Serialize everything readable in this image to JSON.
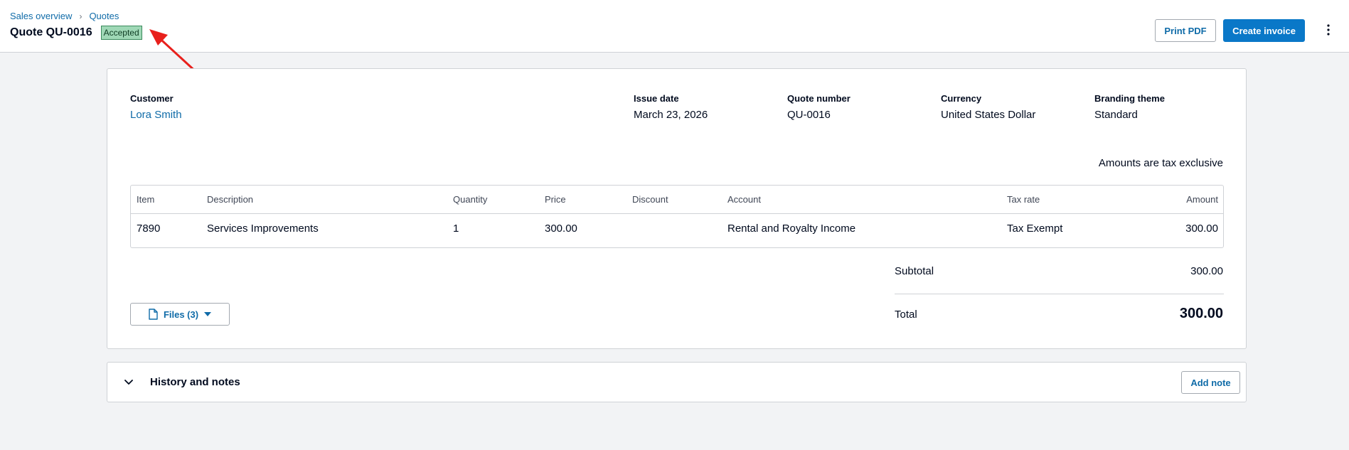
{
  "breadcrumb": {
    "items": [
      "Sales overview",
      "Quotes"
    ],
    "separator": "›"
  },
  "header": {
    "title": "Quote QU-0016",
    "status": "Accepted",
    "print_label": "Print PDF",
    "create_label": "Create invoice"
  },
  "quote": {
    "customer_label": "Customer",
    "customer_name": "Lora Smith",
    "issue_date_label": "Issue date",
    "issue_date": "March 23, 2026",
    "number_label": "Quote number",
    "number": "QU-0016",
    "currency_label": "Currency",
    "currency": "United States Dollar",
    "branding_label": "Branding theme",
    "branding": "Standard",
    "tax_note": "Amounts are tax exclusive"
  },
  "table": {
    "columns": [
      "Item",
      "Description",
      "Quantity",
      "Price",
      "Discount",
      "Account",
      "Tax rate",
      "Amount"
    ],
    "rows": [
      [
        "7890",
        "Services Improvements",
        "1",
        "300.00",
        "",
        "Rental and Royalty Income",
        "Tax Exempt",
        "300.00"
      ]
    ]
  },
  "summary": {
    "subtotal_label": "Subtotal",
    "subtotal": "300.00",
    "total_label": "Total",
    "total": "300.00"
  },
  "files": {
    "label": "Files (3)"
  },
  "history": {
    "title": "History and notes",
    "add_note_label": "Add note"
  },
  "colors": {
    "primary": "#0a78c8",
    "link": "#0f6ba8",
    "badge_bg": "#9fd8b6",
    "annotation_arrow": "#e8201c"
  }
}
